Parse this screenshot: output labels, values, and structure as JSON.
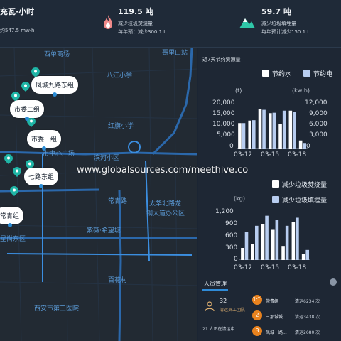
{
  "top_stats": [
    {
      "value": "充瓦·小时",
      "subline": "约547.5 mw·h"
    },
    {
      "value": "119.5 吨",
      "label": "减少垃圾焚烧量",
      "sub": "每年预计减少300.1 t"
    },
    {
      "value": "59.7 吨",
      "label": "减少垃圾填埋量",
      "sub": "每年预计减少150.1 t"
    }
  ],
  "map": {
    "pois": [
      "西单商场",
      "哥里山站",
      "八江小学",
      "红旗小学",
      "市中心广场",
      "滨河小区",
      "常青路",
      "太华北路龙",
      "钢大道办公区",
      "紫薇·希望城",
      "百花村",
      "西安市第三医院",
      "星尚东区"
    ],
    "bubbles": [
      "凤城九路东组",
      "市委二组",
      "市委一组",
      "七路东组",
      "常青组"
    ]
  },
  "chart_panel": {
    "title": "近7天节约资源量"
  },
  "chart_data": [
    {
      "type": "bar",
      "legend": [
        "节约水",
        "节约电"
      ],
      "left_unit": "(t)",
      "right_unit": "(kw·h)",
      "left_ticks": [
        "20,000",
        "15,000",
        "10,000",
        "5,000",
        "0"
      ],
      "right_ticks": [
        "12,000",
        "9,000",
        "6,000",
        "3,000",
        "0"
      ],
      "x_ticks": [
        "03-12",
        "03-15",
        "03-18"
      ],
      "ylim_left": [
        0,
        20000
      ],
      "ylim_right": [
        0,
        12000
      ],
      "series": [
        {
          "name": "节约水",
          "axis": "left",
          "color": "#ffffff",
          "values": [
            10500,
            11500,
            16000,
            14500,
            10000,
            15500,
            3500
          ]
        },
        {
          "name": "节约电",
          "axis": "right",
          "color": "#b8cdf0",
          "values": [
            6300,
            7000,
            9500,
            8800,
            9300,
            9000,
            1500
          ]
        }
      ],
      "grid": false,
      "legend_position": "top-right"
    },
    {
      "type": "bar",
      "legend": [
        "减少垃圾焚烧量",
        "减少垃圾填埋量"
      ],
      "left_unit": "(kg)",
      "left_ticks": [
        "1,200",
        "900",
        "600",
        "300",
        "0"
      ],
      "x_ticks": [
        "03-12",
        "03-15",
        "03-18"
      ],
      "ylim_left": [
        0,
        1200
      ],
      "series": [
        {
          "name": "减少垃圾焚烧量",
          "axis": "left",
          "color": "#ffffff",
          "values": [
            300,
            400,
            900,
            750,
            350,
            950,
            150
          ]
        },
        {
          "name": "减少垃圾填埋量",
          "axis": "left",
          "color": "#b8cdf0",
          "values": [
            700,
            850,
            1100,
            1000,
            850,
            1050,
            250
          ]
        }
      ],
      "grid": false,
      "legend_position": "top-right"
    }
  ],
  "staff": {
    "title": "人员管理",
    "count": "32",
    "count_label": "清运员工团队",
    "active": "21 人正在清运中...",
    "rankings": [
      {
        "rank": "1个",
        "name": "常青组",
        "value": "清运6234 次"
      },
      {
        "rank": "2",
        "name": "三那城城...",
        "value": "清运3438 次"
      },
      {
        "rank": "3",
        "name": "凤城一路...",
        "value": "清运2680 次"
      }
    ]
  },
  "watermark": "www.globalsources.com/meethive.co",
  "colors": {
    "accent": "#2f8bd8",
    "marker": "#1fb5a6",
    "road": "#2c6fb8",
    "orange": "#e8821e"
  }
}
